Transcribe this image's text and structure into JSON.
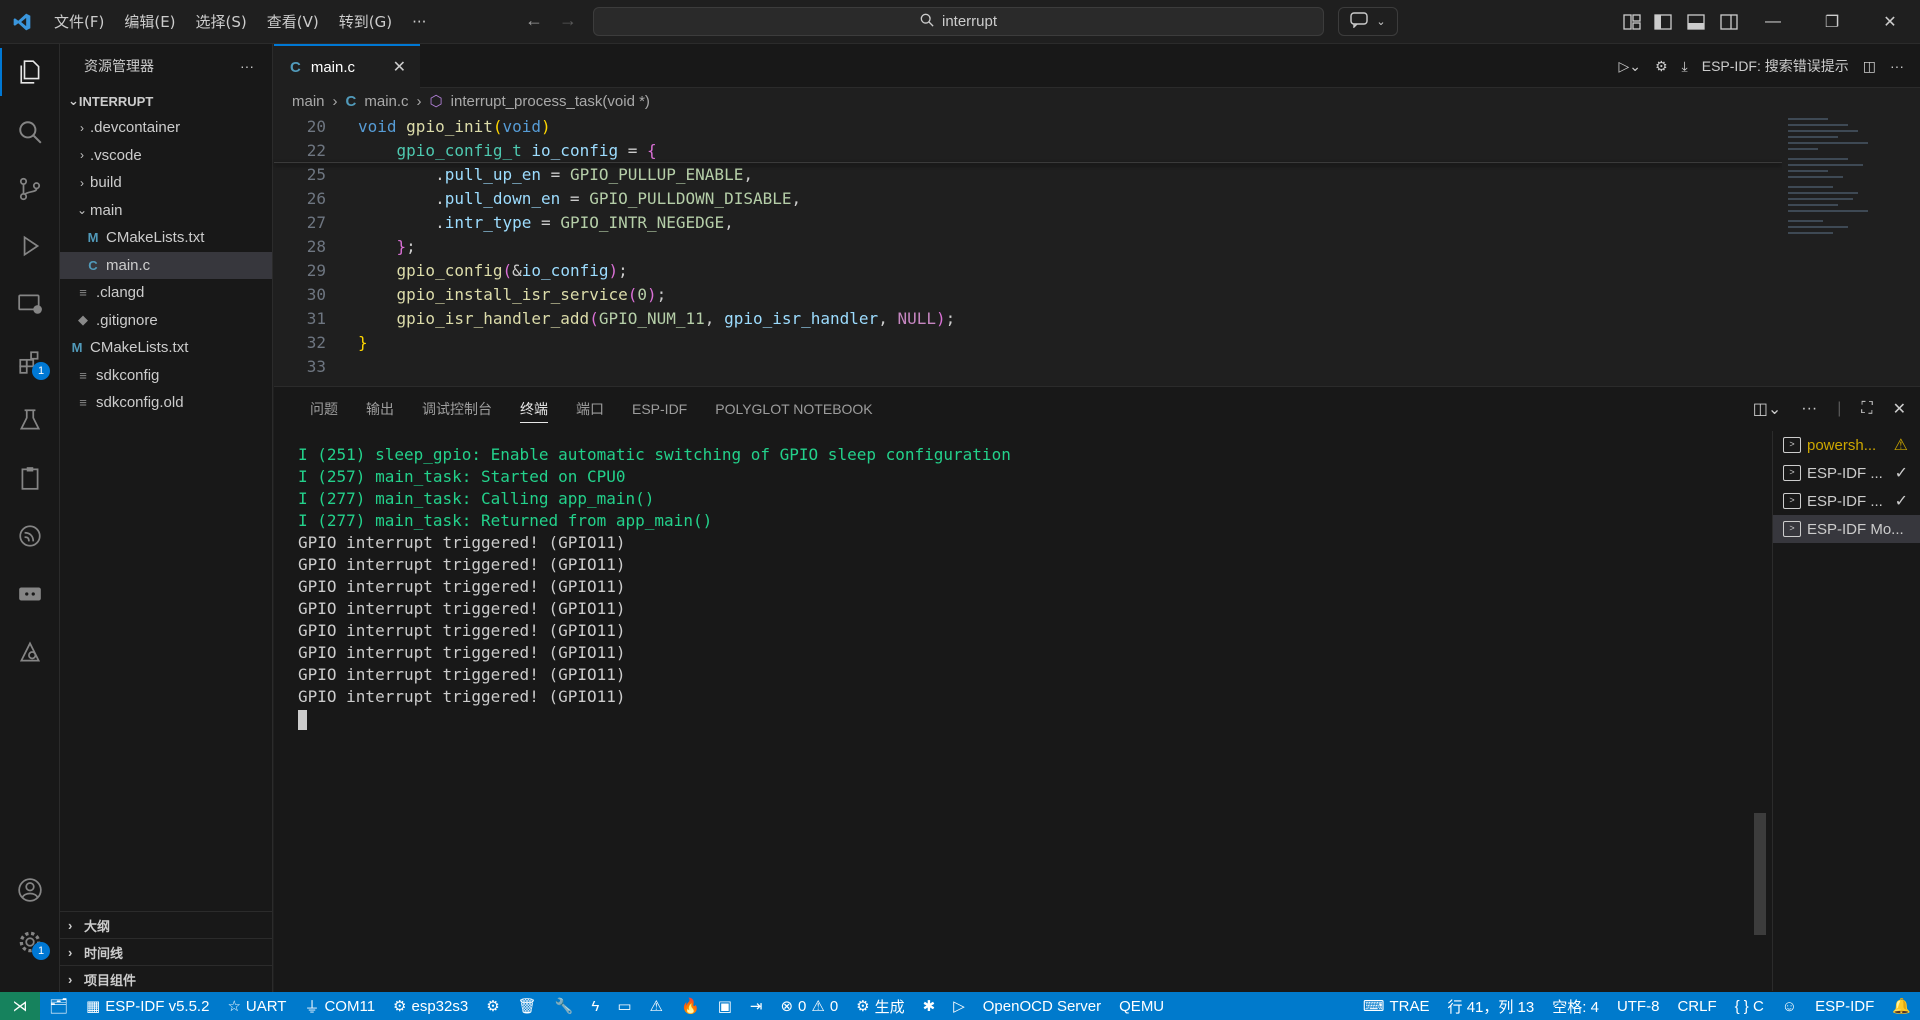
{
  "titlebar": {
    "menus": [
      "文件(F)",
      "编辑(E)",
      "选择(S)",
      "查看(V)",
      "转到(G)",
      "···"
    ],
    "search": "interrupt"
  },
  "explorer": {
    "title": "资源管理器",
    "more": "···",
    "root": "INTERRUPT",
    "items": [
      {
        "label": ".devcontainer",
        "kind": "folder"
      },
      {
        "label": ".vscode",
        "kind": "folder"
      },
      {
        "label": "build",
        "kind": "folder"
      },
      {
        "label": "main",
        "kind": "folder-open"
      },
      {
        "label": "CMakeLists.txt",
        "kind": "cmake"
      },
      {
        "label": "main.c",
        "kind": "c"
      },
      {
        "label": ".clangd",
        "kind": "file"
      },
      {
        "label": ".gitignore",
        "kind": "file"
      },
      {
        "label": "CMakeLists.txt",
        "kind": "cmake"
      },
      {
        "label": "sdkconfig",
        "kind": "file"
      },
      {
        "label": "sdkconfig.old",
        "kind": "file"
      }
    ],
    "bottom_sections": [
      "大纲",
      "时间线",
      "项目组件"
    ]
  },
  "activitybar": {
    "extensions_badge": "1",
    "settings_badge": "1"
  },
  "editor": {
    "tab": "main.c",
    "tab_icon": "C",
    "toolbar_label": "ESP-IDF: 搜索错误提示",
    "breadcrumb": [
      "main",
      "main.c",
      "interrupt_process_task(void *)"
    ],
    "lines": [
      {
        "n": "20",
        "t": "void gpio_init(void)"
      },
      {
        "n": "22",
        "t": "    gpio_config_t io_config = {"
      },
      {
        "n": "25",
        "t": "        .pull_up_en = GPIO_PULLUP_ENABLE,"
      },
      {
        "n": "26",
        "t": "        .pull_down_en = GPIO_PULLDOWN_DISABLE,"
      },
      {
        "n": "27",
        "t": "        .intr_type = GPIO_INTR_NEGEDGE,"
      },
      {
        "n": "28",
        "t": "    };"
      },
      {
        "n": "29",
        "t": "    gpio_config(&io_config);"
      },
      {
        "n": "30",
        "t": "    gpio_install_isr_service(0);"
      },
      {
        "n": "31",
        "t": "    gpio_isr_handler_add(GPIO_NUM_11, gpio_isr_handler, NULL);"
      },
      {
        "n": "32",
        "t": "}"
      },
      {
        "n": "33",
        "t": ""
      }
    ]
  },
  "panel": {
    "tabs": [
      "问题",
      "输出",
      "调试控制台",
      "终端",
      "端口",
      "ESP-IDF",
      "POLYGLOT NOTEBOOK"
    ],
    "active_tab": "终端",
    "terminal_lines": [
      {
        "text": "I (251) sleep_gpio: Enable automatic switching of GPIO sleep configuration",
        "green": true
      },
      {
        "text": "I (257) main_task: Started on CPU0",
        "green": true
      },
      {
        "text": "I (277) main_task: Calling app_main()",
        "green": true
      },
      {
        "text": "I (277) main_task: Returned from app_main()",
        "green": true
      },
      {
        "text": "GPIO interrupt triggered! (GPIO11)",
        "green": false
      },
      {
        "text": "GPIO interrupt triggered! (GPIO11)",
        "green": false
      },
      {
        "text": "GPIO interrupt triggered! (GPIO11)",
        "green": false
      },
      {
        "text": "GPIO interrupt triggered! (GPIO11)",
        "green": false
      },
      {
        "text": "GPIO interrupt triggered! (GPIO11)",
        "green": false
      },
      {
        "text": "GPIO interrupt triggered! (GPIO11)",
        "green": false
      },
      {
        "text": "GPIO interrupt triggered! (GPIO11)",
        "green": false
      },
      {
        "text": "GPIO interrupt triggered! (GPIO11)",
        "green": false
      }
    ],
    "terminals": [
      {
        "label": "powersh...",
        "status": "warning"
      },
      {
        "label": "ESP-IDF ...",
        "status": "check"
      },
      {
        "label": "ESP-IDF ...",
        "status": "check"
      },
      {
        "label": "ESP-IDF Mo...",
        "status": ""
      }
    ]
  },
  "statusbar": {
    "left": [
      "ESP-IDF v5.5.2",
      "UART",
      "COM11",
      "esp32s3",
      "",
      "",
      "",
      "",
      "",
      "",
      "",
      "",
      "0",
      "0",
      "生成",
      "",
      "",
      "OpenOCD Server",
      "QEMU"
    ],
    "right": [
      "TRAE",
      "行 41，列 13",
      "空格: 4",
      "UTF-8",
      "CRLF",
      "{ } C",
      "ESP-IDF"
    ]
  },
  "colors": {
    "accent": "#007acc",
    "terminal_green": "#23d18b",
    "warning": "#cca700"
  }
}
